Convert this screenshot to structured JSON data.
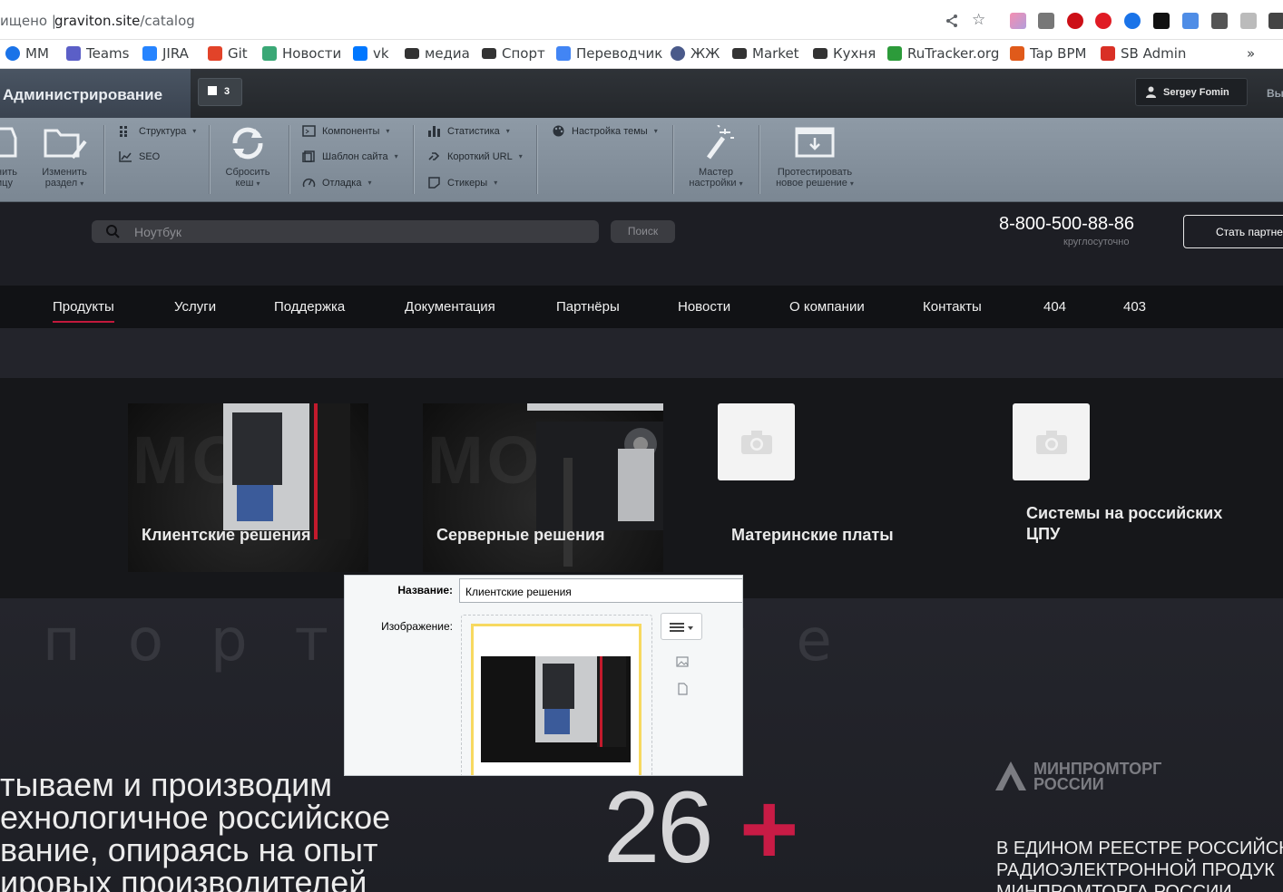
{
  "browser": {
    "url_prefix": "ищено |",
    "url_host": "graviton.site",
    "url_path": "/catalog",
    "bookmarks": [
      {
        "label": "MM",
        "color": "#1a73e8"
      },
      {
        "label": "Teams",
        "color": "#5b5fc7"
      },
      {
        "label": "JIRA",
        "color": "#2684ff"
      },
      {
        "label": "Git",
        "color": "#e24329"
      },
      {
        "label": "Новости",
        "color": "#3aa876"
      },
      {
        "label": "vk",
        "color": "#0077ff"
      },
      {
        "label": "медиа",
        "color": "#333333"
      },
      {
        "label": "Спорт",
        "color": "#333333"
      },
      {
        "label": "Переводчик",
        "color": "#4285f4"
      },
      {
        "label": "ЖЖ",
        "color": "#4a5a8a"
      },
      {
        "label": "Market",
        "color": "#333333"
      },
      {
        "label": "Кухня",
        "color": "#333333"
      },
      {
        "label": "RuTracker.org",
        "color": "#2c9b3a"
      },
      {
        "label": "Tap BPM",
        "color": "#e05a1a"
      },
      {
        "label": "SB Admin",
        "color": "#d93025"
      }
    ],
    "more": "»"
  },
  "admin": {
    "title": "Администрирование",
    "notifications_count": "3",
    "user_name": "Sergey Fomin",
    "exit_label": "Вы",
    "tools": {
      "edit_page": "нить\nицу",
      "edit_section_line1": "Изменить",
      "edit_section_line2": "раздел",
      "structure": "Структура",
      "seo": "SEO",
      "reset_cache_line1": "Сбросить",
      "reset_cache_line2": "кеш",
      "components": "Компоненты",
      "site_template": "Шаблон сайта",
      "debug": "Отладка",
      "statistics": "Статистика",
      "short_url": "Короткий URL",
      "stickers": "Стикеры",
      "theme_settings": "Настройка темы",
      "wizard_line1": "Мастер",
      "wizard_line2": "настройки",
      "test_line1": "Протестировать",
      "test_line2": "новое решение"
    }
  },
  "header": {
    "search_placeholder": "Ноутбук",
    "search_button": "Поиск",
    "phone": "8-800-500-88-86",
    "phone_note": "круглосуточно",
    "partner_button": "Стать партне"
  },
  "nav": [
    "Продукты",
    "Услуги",
    "Поддержка",
    "Документация",
    "Партнёры",
    "Новости",
    "О компании",
    "Контакты",
    "404",
    "403"
  ],
  "catalog": [
    {
      "title": "Клиентские решения"
    },
    {
      "title": "Серверные решения"
    },
    {
      "title": "Материнские платы"
    },
    {
      "title": "Системы на российских ЦПУ"
    }
  ],
  "hero": {
    "background_letters": "порт   щение",
    "slogan": "тываем и производим\nехнологичное российское\nвание, опираясь на опыт\nировых производителей",
    "number": "26",
    "plus": "+",
    "ministry": "МИНПРОМТОРГ\nРОССИИ",
    "registry": "В ЕДИНОМ РЕЕСТРЕ РОССИЙСК\nРАДИОЭЛЕКТРОННОЙ ПРОДУК\nМИНПРОМТОРГА РОССИИ"
  },
  "edit_popup": {
    "name_label": "Название:",
    "name_value": "Клиентские решения",
    "image_label": "Изображение:"
  },
  "colors": {
    "accent": "#c2193c",
    "plus": "#c81b45",
    "admin_bar": "#8e9aa6"
  }
}
